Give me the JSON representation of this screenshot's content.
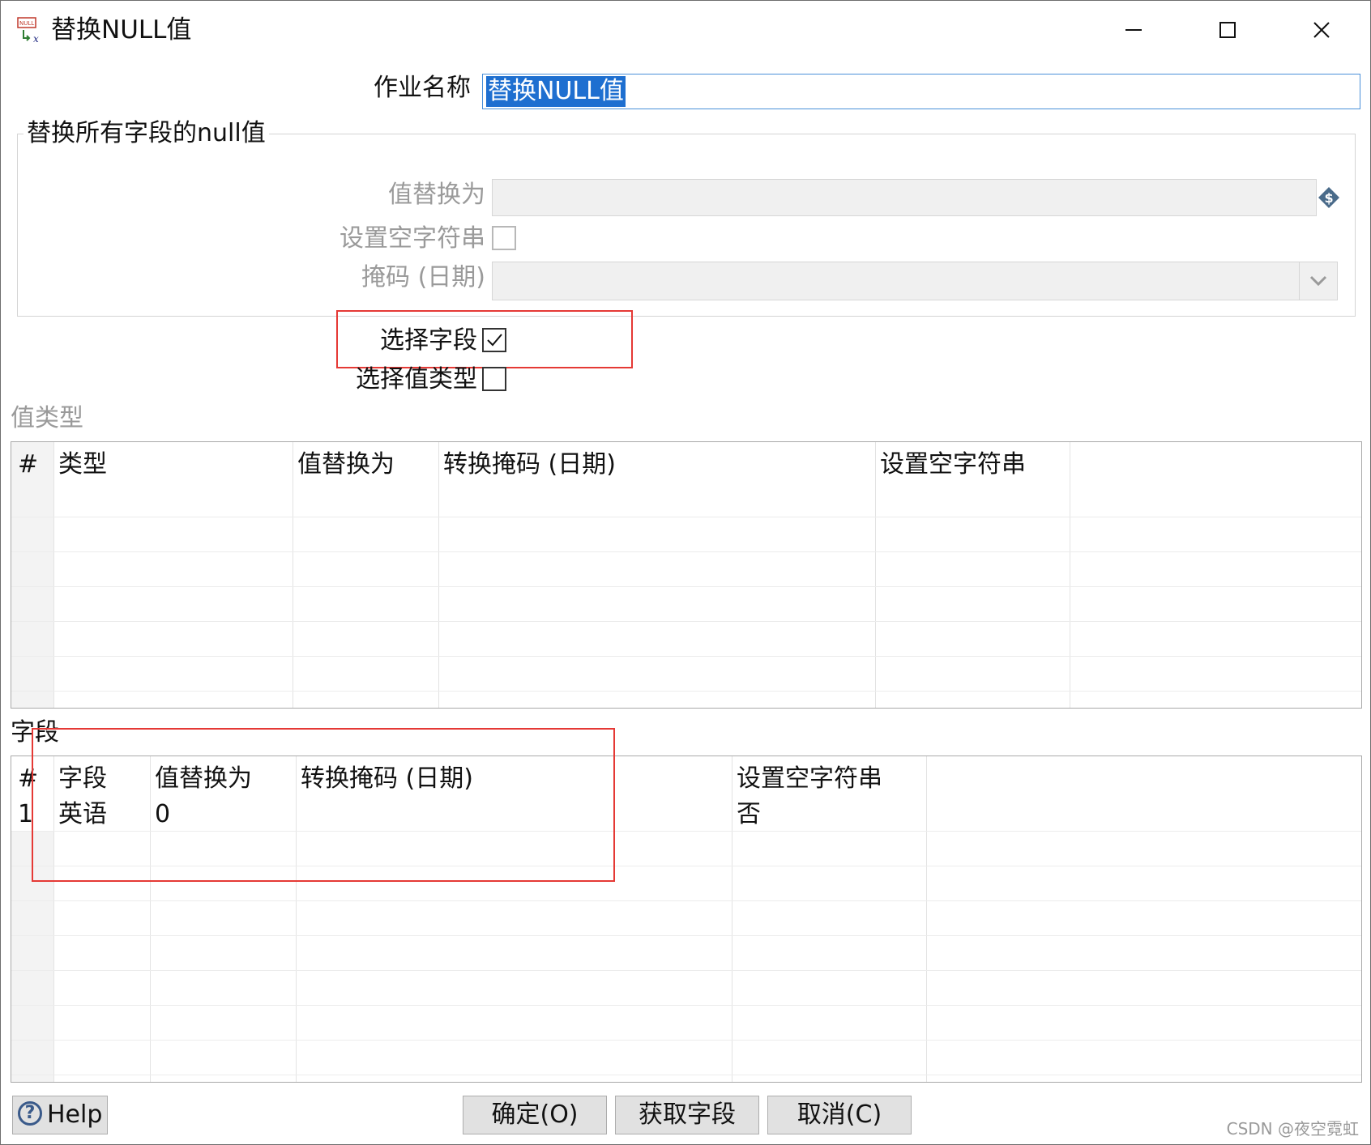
{
  "window": {
    "title": "替换NULL值"
  },
  "job": {
    "label": "作业名称",
    "value": "替换NULL值"
  },
  "replace_all": {
    "group_title": "替换所有字段的null值",
    "value_label": "值替换为",
    "empty_string_label": "设置空字符串",
    "mask_label": "掩码 (日期)"
  },
  "options": {
    "select_fields_label": "选择字段",
    "select_fields_checked": true,
    "select_value_type_label": "选择值类型",
    "select_value_type_checked": false
  },
  "value_type_table": {
    "section_label": "值类型",
    "columns": [
      "#",
      "类型",
      "值替换为",
      "转换掩码 (日期)",
      "设置空字符串"
    ],
    "rows": []
  },
  "fields_table": {
    "section_label": "字段",
    "columns": [
      "#",
      "字段",
      "值替换为",
      "转换掩码 (日期)",
      "设置空字符串"
    ],
    "rows": [
      {
        "num": "1",
        "field": "英语",
        "value": "0",
        "mask": "",
        "empty": "否"
      }
    ]
  },
  "buttons": {
    "help": "Help",
    "ok": "确定(O)",
    "get_fields": "获取字段",
    "cancel": "取消(C)"
  },
  "watermark": "CSDN @夜空霓虹",
  "colors": {
    "highlight_red": "#e53935",
    "selection_blue": "#1e6fd0"
  }
}
